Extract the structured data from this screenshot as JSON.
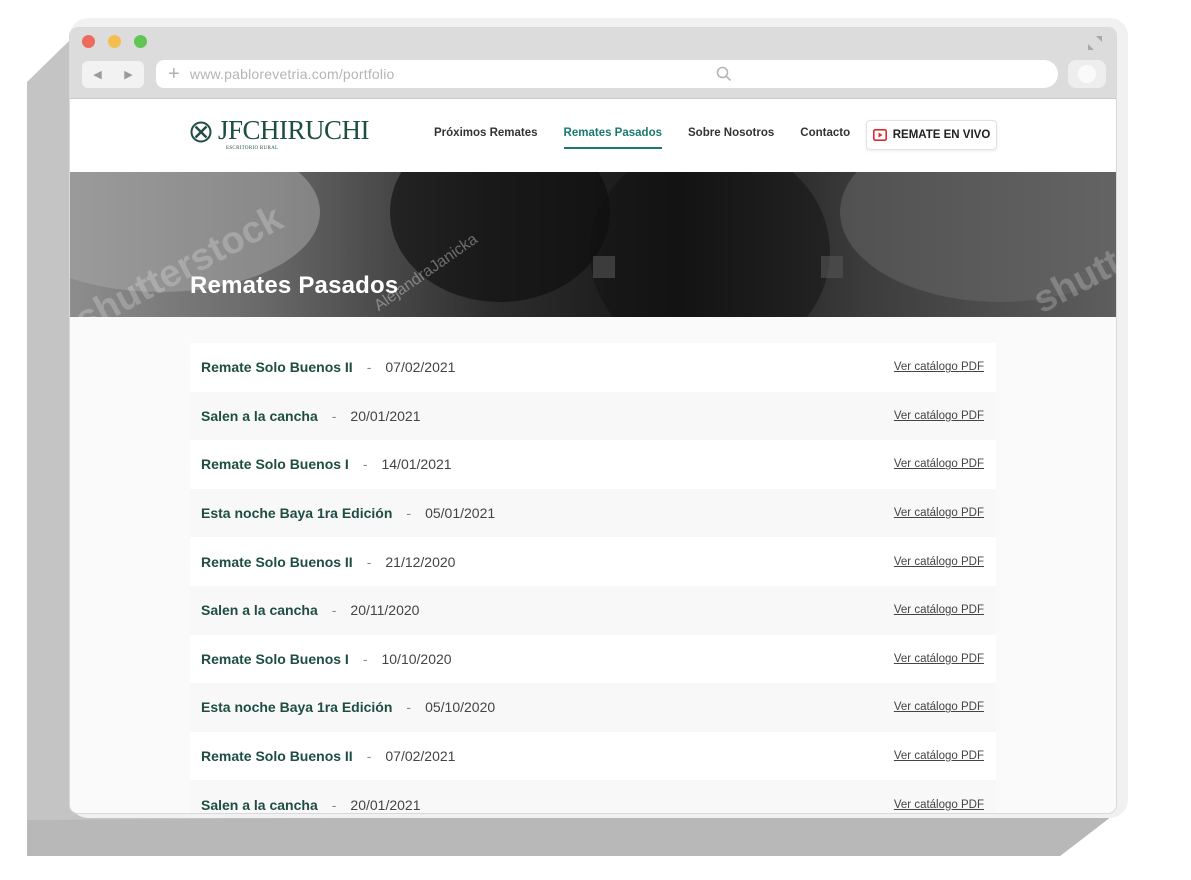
{
  "browser": {
    "url": "www.pablorevetria.com/portfolio",
    "search_placeholder": ""
  },
  "site": {
    "logo_text": "JFCHIRUCHI",
    "logo_sub": "ESCRITORIO RURAL",
    "nav": [
      "Próximos Remates",
      "Remates Pasados",
      "Sobre Nosotros",
      "Contacto"
    ],
    "active_nav": "Remates Pasados",
    "live_button": "REMATE EN VIVO",
    "accent_color": "#1a7a6e",
    "brand_color": "#1e4d42",
    "live_icon_color": "#e0282d"
  },
  "hero": {
    "title": "Remates Pasados",
    "watermarks": [
      "shutterstock",
      "AlejandraJanicka",
      "shutterst"
    ]
  },
  "remates": [
    {
      "name": "Remate Solo Buenos II",
      "date": "07/02/2021",
      "link": "Ver catálogo PDF"
    },
    {
      "name": "Salen a la cancha",
      "date": "20/01/2021",
      "link": "Ver catálogo PDF"
    },
    {
      "name": "Remate Solo Buenos I",
      "date": "14/01/2021",
      "link": "Ver catálogo PDF"
    },
    {
      "name": "Esta noche Baya 1ra Edición",
      "date": "05/01/2021",
      "link": "Ver catálogo PDF"
    },
    {
      "name": "Remate Solo Buenos II",
      "date": "21/12/2020",
      "link": "Ver catálogo PDF"
    },
    {
      "name": "Salen a la cancha",
      "date": "20/11/2020",
      "link": "Ver catálogo PDF"
    },
    {
      "name": "Remate Solo Buenos I",
      "date": "10/10/2020",
      "link": "Ver catálogo PDF"
    },
    {
      "name": "Esta noche Baya 1ra Edición",
      "date": "05/10/2020",
      "link": "Ver catálogo PDF"
    },
    {
      "name": "Remate Solo Buenos II",
      "date": "07/02/2021",
      "link": "Ver catálogo PDF"
    },
    {
      "name": "Salen a la cancha",
      "date": "20/01/2021",
      "link": "Ver catálogo PDF"
    }
  ],
  "separator": "-"
}
